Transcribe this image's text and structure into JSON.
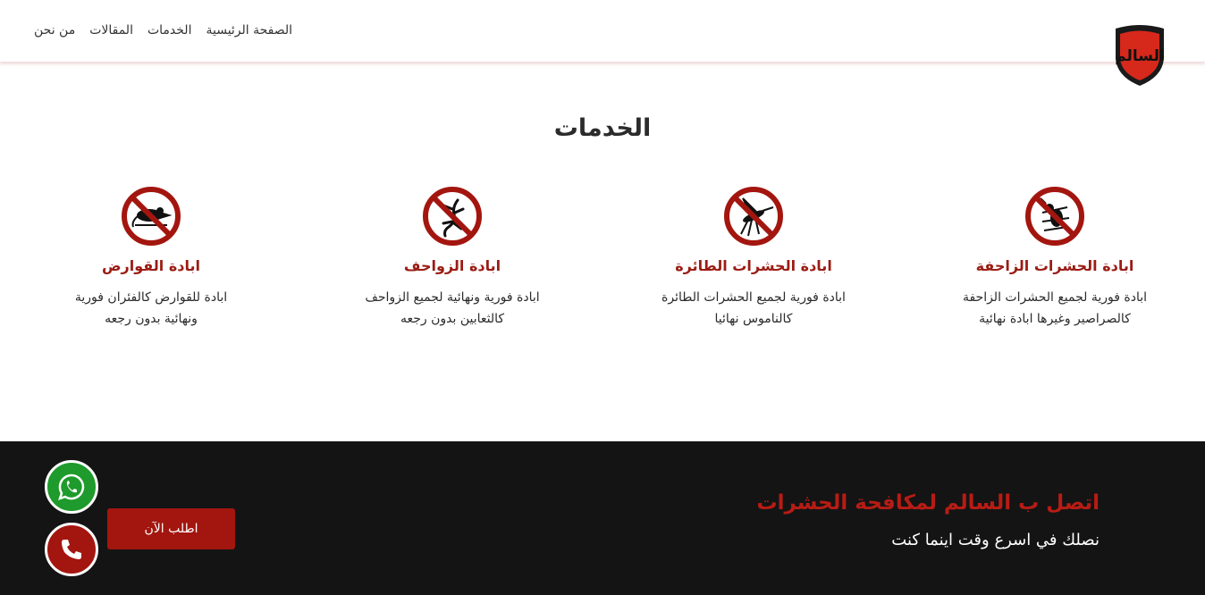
{
  "header": {
    "logo_text": "السالم",
    "nav": [
      {
        "label": "الصفحة الرئيسية",
        "icon": ""
      },
      {
        "label": "الخدمات"
      },
      {
        "label": "المقالات"
      },
      {
        "label": "من نحن"
      }
    ]
  },
  "services": {
    "title": "الخدمات",
    "items": [
      {
        "icon": "no-crawling-insects-icon",
        "title": "ابادة الحشرات الزاحفة",
        "line1": "ابادة فورية لجميع الحشرات الزاحفة",
        "line2": "كالصراصير وغيرها ابادة نهائية"
      },
      {
        "icon": "no-flying-insects-icon",
        "title": "ابادة الحشرات الطائرة",
        "line1": "ابادة فورية لجميع الحشرات الطائرة",
        "line2": "كالناموس نهائيا"
      },
      {
        "icon": "no-reptiles-icon",
        "title": "ابادة الزواحف",
        "line1": "ابادة فورية ونهائية لجميع الزواحف",
        "line2": "كالثعابين بدون رجعه"
      },
      {
        "icon": "no-rodents-icon",
        "title": "ابادة القوارض",
        "line1": "ابادة للقوارض كالفئران فورية",
        "line2": "ونهائية بدون رجعه"
      }
    ]
  },
  "footer": {
    "title": "اتصل ب السالم لمكافحة الحشرات",
    "subtitle": "نصلك في اسرع وقت اينما كنت",
    "order_label": "اطلب الآن"
  },
  "colors": {
    "brand_red": "#a3160f",
    "whatsapp_green": "#1f9a2c",
    "footer_bg": "#141414"
  }
}
